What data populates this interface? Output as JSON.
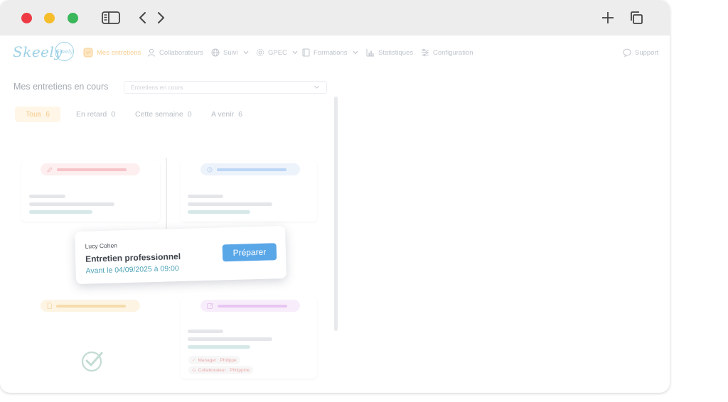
{
  "app": {
    "logo_text": "Skeely",
    "logo_badge_text": "Skeely"
  },
  "nav": {
    "items": [
      {
        "label": "Mes entretiens",
        "icon": "interview-icon",
        "active": true
      },
      {
        "label": "Collaborateurs",
        "icon": "user-icon"
      },
      {
        "label": "Suivi",
        "icon": "globe-icon",
        "has_dropdown": true
      },
      {
        "label": "GPEC",
        "icon": "gear-icon",
        "has_dropdown": true
      },
      {
        "label": "Formations",
        "icon": "book-icon",
        "has_dropdown": true
      },
      {
        "label": "Statistiques",
        "icon": "bar-chart-icon"
      },
      {
        "label": "Configuration",
        "icon": "list-settings-icon"
      }
    ],
    "support_label": "Support"
  },
  "main": {
    "title": "Mes entretiens en cours",
    "filter_select": {
      "value": "Entretiens en cours"
    },
    "tabs": [
      {
        "label": "Tous",
        "count": "6",
        "active": true
      },
      {
        "label": "En retard",
        "count": "0"
      },
      {
        "label": "Cette semaine",
        "count": "0"
      },
      {
        "label": "A venir",
        "count": "6"
      }
    ]
  },
  "featured_card": {
    "person": "Lucy Cohen",
    "title": "Entretien professionnel",
    "deadline": "Avant le 04/09/2025 à 09:00",
    "button_label": "Préparer"
  },
  "ghost_tags": {
    "manager": "Manager : Philippe",
    "collaborator": "Collaborateur : Philippine"
  },
  "colors": {
    "accent_blue": "#5aa7e8",
    "active_tab_bg": "#fff6e8",
    "active_nav": "#f7cf93",
    "date_teal": "#4fa3b6"
  }
}
